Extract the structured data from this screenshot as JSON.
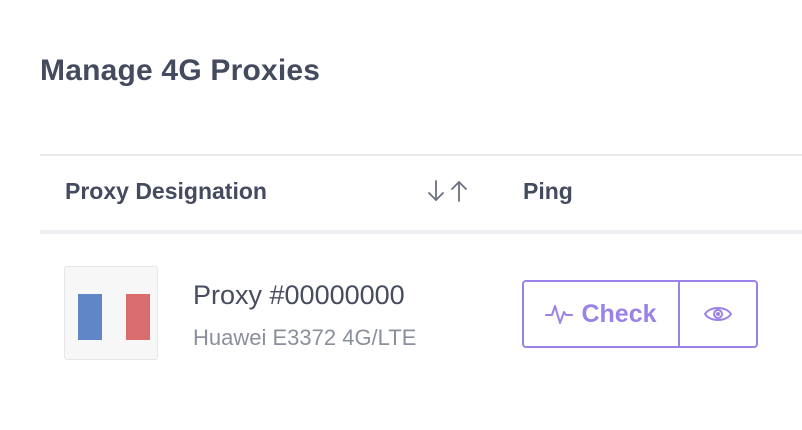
{
  "page": {
    "title": "Manage 4G Proxies"
  },
  "table": {
    "columns": {
      "designation": "Proxy Designation",
      "ping": "Ping"
    },
    "rows": [
      {
        "name": "Proxy #00000000",
        "device": "Huawei E3372 4G/LTE",
        "country_flag": "flag-france-icon",
        "check_label": "Check"
      }
    ]
  },
  "icons": {
    "sort": "sort-arrows-icon",
    "check": "activity-pulse-icon",
    "view": "eye-icon"
  },
  "colors": {
    "accent": "#9a82e6",
    "flag_blue": "#5f86c6",
    "flag_white": "#f7f7f8",
    "flag_red": "#d96c6d"
  }
}
